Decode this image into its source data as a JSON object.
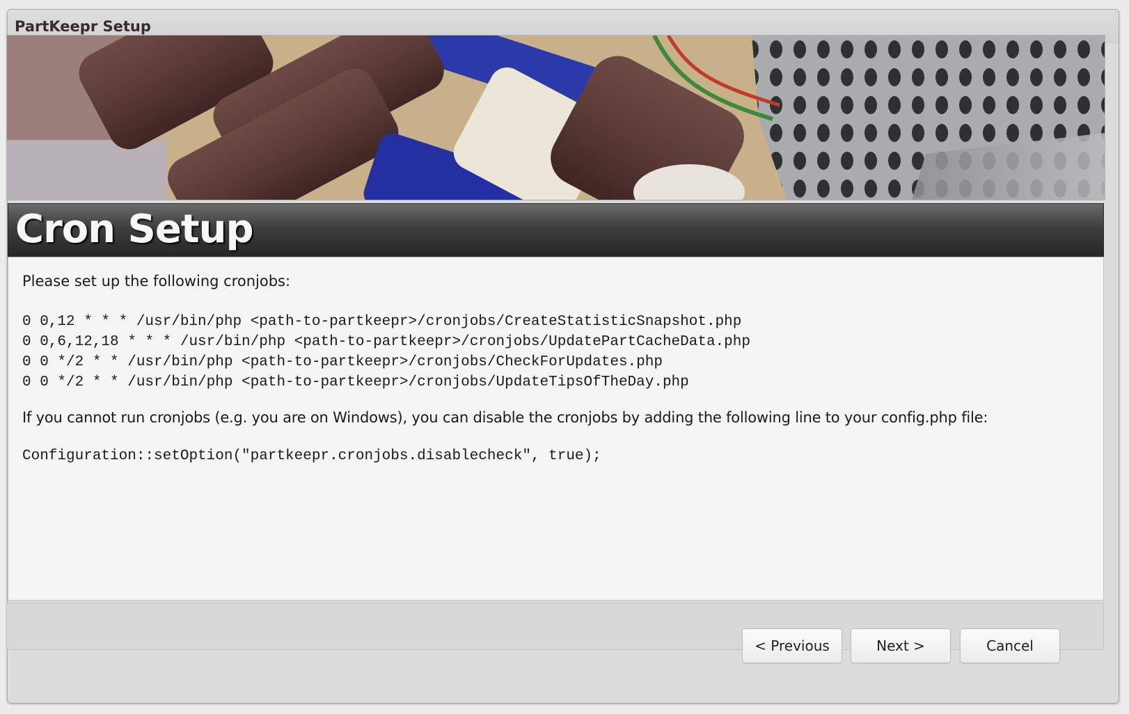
{
  "window": {
    "title": "PartKeepr Setup"
  },
  "banner": {
    "description_icon": "capacitors-photo"
  },
  "page": {
    "heading": "Cron Setup",
    "intro": "Please set up the following cronjobs:",
    "cronjobs": [
      "0 0,12 * * * /usr/bin/php <path-to-partkeepr>/cronjobs/CreateStatisticSnapshot.php",
      "0 0,6,12,18 * * * /usr/bin/php <path-to-partkeepr>/cronjobs/UpdatePartCacheData.php",
      "0 0 */2 * * /usr/bin/php <path-to-partkeepr>/cronjobs/CheckForUpdates.php",
      "0 0 */2 * * /usr/bin/php <path-to-partkeepr>/cronjobs/UpdateTipsOfTheDay.php"
    ],
    "note": "If you cannot run cronjobs (e.g. you are on Windows), you can disable the cronjobs by adding the following line to your config.php file:",
    "config_line": "Configuration::setOption(\"partkeepr.cronjobs.disablecheck\", true);"
  },
  "buttons": {
    "previous": "< Previous",
    "next": "Next >",
    "cancel": "Cancel"
  },
  "colors": {
    "header_bar": "#3e3e3e",
    "content_bg": "#f5f5f5",
    "window_bg": "#dcdcdc"
  }
}
